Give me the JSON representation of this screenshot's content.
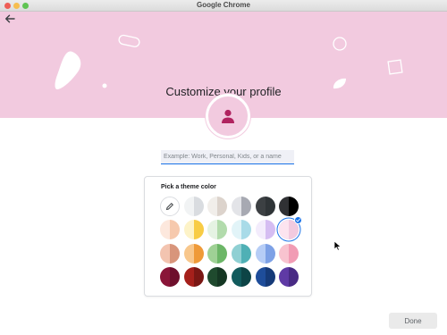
{
  "window": {
    "title": "Google Chrome"
  },
  "header": {
    "title": "Customize your profile"
  },
  "profile_name": {
    "placeholder": "Example: Work, Personal, Kids, or a name",
    "value": ""
  },
  "theme": {
    "title": "Pick a theme color",
    "selected_index": 11,
    "swatches": [
      {
        "kind": "custom",
        "icon": "pencil-icon",
        "left": "#ffffff",
        "right": "#ffffff"
      },
      {
        "left": "#f1f3f4",
        "right": "#d9dce0"
      },
      {
        "left": "#f1eeea",
        "right": "#dcd3cc"
      },
      {
        "left": "#e3e4e8",
        "right": "#a7a9b2"
      },
      {
        "left": "#3c4043",
        "right": "#2f3437"
      },
      {
        "left": "#303134",
        "right": "#000000"
      },
      {
        "left": "#fde8dd",
        "right": "#f6c9ad"
      },
      {
        "left": "#fdf3c8",
        "right": "#f8cc45"
      },
      {
        "left": "#e5f3e3",
        "right": "#b2dbac"
      },
      {
        "left": "#e2f4f8",
        "right": "#a9dbe8"
      },
      {
        "left": "#f3ecfc",
        "right": "#d5bdf2"
      },
      {
        "left": "#fce4ef",
        "right": "#f2cadf"
      },
      {
        "left": "#f3c4b0",
        "right": "#d8957b"
      },
      {
        "left": "#f8c78c",
        "right": "#ef9a38"
      },
      {
        "left": "#9fd195",
        "right": "#6cb667"
      },
      {
        "left": "#8fd0d3",
        "right": "#4fb0b5"
      },
      {
        "left": "#b6cdf6",
        "right": "#7da1e6"
      },
      {
        "left": "#f8c3cf",
        "right": "#f19cb4"
      },
      {
        "left": "#8a1538",
        "right": "#6e0f2c"
      },
      {
        "left": "#a5201b",
        "right": "#7a1714"
      },
      {
        "left": "#1f4a2e",
        "right": "#153723"
      },
      {
        "left": "#125b5d",
        "right": "#0d4446"
      },
      {
        "left": "#1e4d9a",
        "right": "#153a78"
      },
      {
        "left": "#5f3aa5",
        "right": "#482a84"
      }
    ]
  },
  "colors": {
    "banner": "#f2cadf",
    "avatar_icon": "#b0235f",
    "accent": "#1a73e8"
  },
  "icons": {
    "back": "arrow-left-icon",
    "avatar": "person-icon",
    "custom": "pencil-icon",
    "selected": "check-icon"
  },
  "footer": {
    "done_label": "Done"
  }
}
